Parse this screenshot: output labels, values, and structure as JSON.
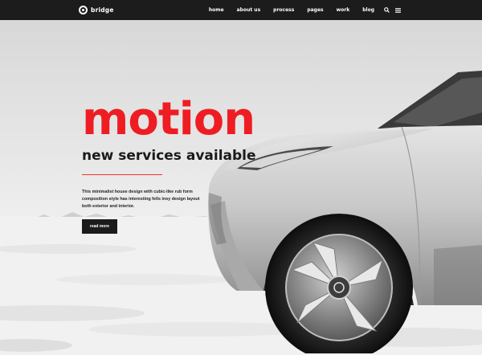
{
  "nav": {
    "logo_text": "bridge",
    "items": [
      {
        "label": "home"
      },
      {
        "label": "about us"
      },
      {
        "label": "process"
      },
      {
        "label": "pages"
      },
      {
        "label": "work"
      },
      {
        "label": "blog"
      }
    ],
    "icons": [
      "search-icon",
      "menu-icon"
    ]
  },
  "hero": {
    "headline": "motion",
    "subheadline": "new services available",
    "body": "This minimalist house design with cubic-like rub form composition style has interesting fells insy design layout both exterior and interior.",
    "cta_label": "read more"
  },
  "colors": {
    "accent": "#ee1d23",
    "nav_bg": "#1c1c1c",
    "button_bg": "#1b1b1b"
  }
}
